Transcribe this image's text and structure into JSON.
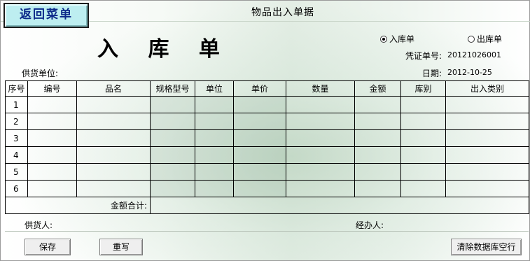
{
  "window": {
    "title": "物品出入单据",
    "back_button": "返回菜单"
  },
  "form": {
    "heading": "入 库 单",
    "radio_in": "入库单",
    "radio_out": "出库单",
    "selected": "入库单",
    "voucher_label": "凭证单号:",
    "voucher_value": "20121026001",
    "date_label": "日期:",
    "date_value": "2012-10-25",
    "supplier_label": "供货单位:"
  },
  "table": {
    "headers": [
      "序号",
      "编号",
      "品名",
      "规格型号",
      "单位",
      "单价",
      "数量",
      "金额",
      "库别",
      "出入类别"
    ],
    "row_numbers": [
      "1",
      "2",
      "3",
      "4",
      "5",
      "6"
    ],
    "total_label": "金额合计:"
  },
  "footer": {
    "supplier_person_label": "供货人:",
    "handler_label": "经办人:",
    "save_button": "保存",
    "rewrite_button": "重写",
    "clear_button": "清除数据库空行"
  }
}
